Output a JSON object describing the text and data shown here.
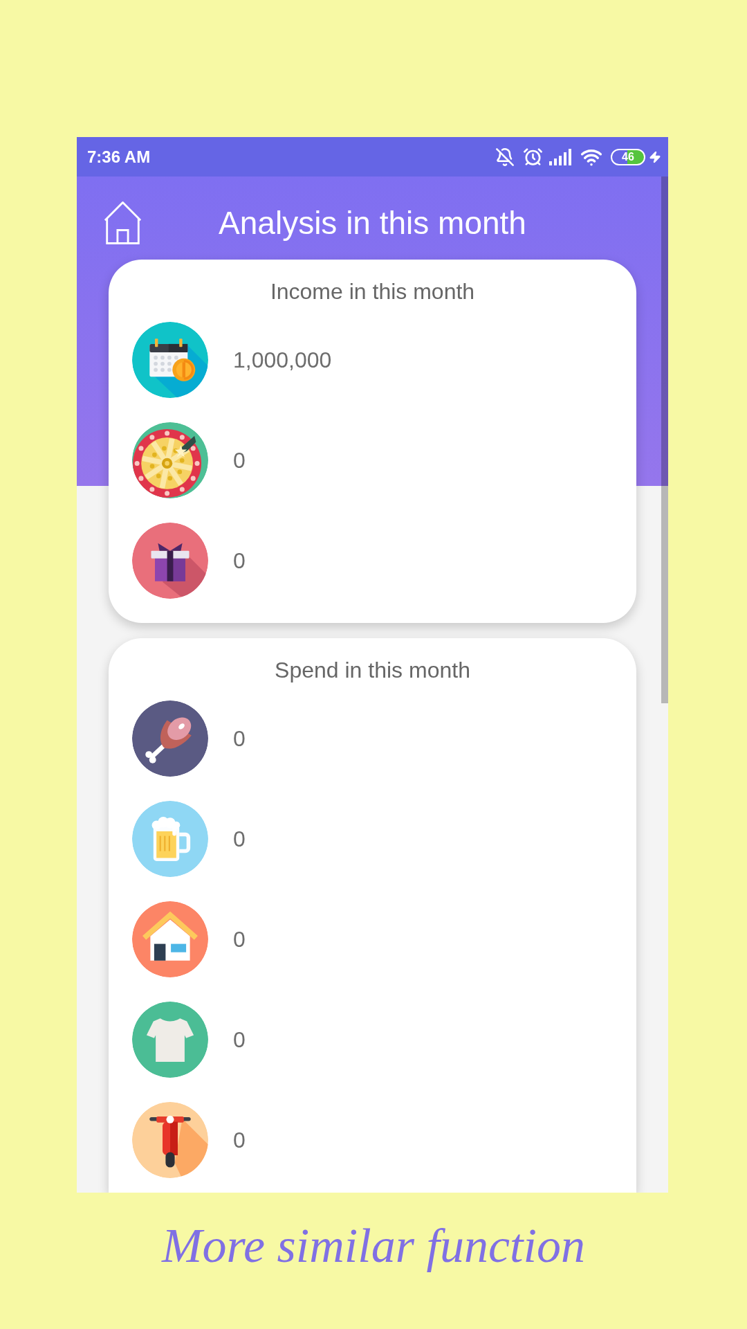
{
  "status_bar": {
    "time": "7:36 AM",
    "battery": "46"
  },
  "header": {
    "title": "Analysis in this month"
  },
  "income": {
    "title": "Income in this month",
    "rows": [
      {
        "amount": "1,000,000"
      },
      {
        "amount": "0"
      },
      {
        "amount": "0"
      }
    ]
  },
  "spend": {
    "title": "Spend in this month",
    "rows": [
      {
        "amount": "0"
      },
      {
        "amount": "0"
      },
      {
        "amount": "0"
      },
      {
        "amount": "0"
      },
      {
        "amount": "0"
      }
    ]
  },
  "caption": "More similar function"
}
